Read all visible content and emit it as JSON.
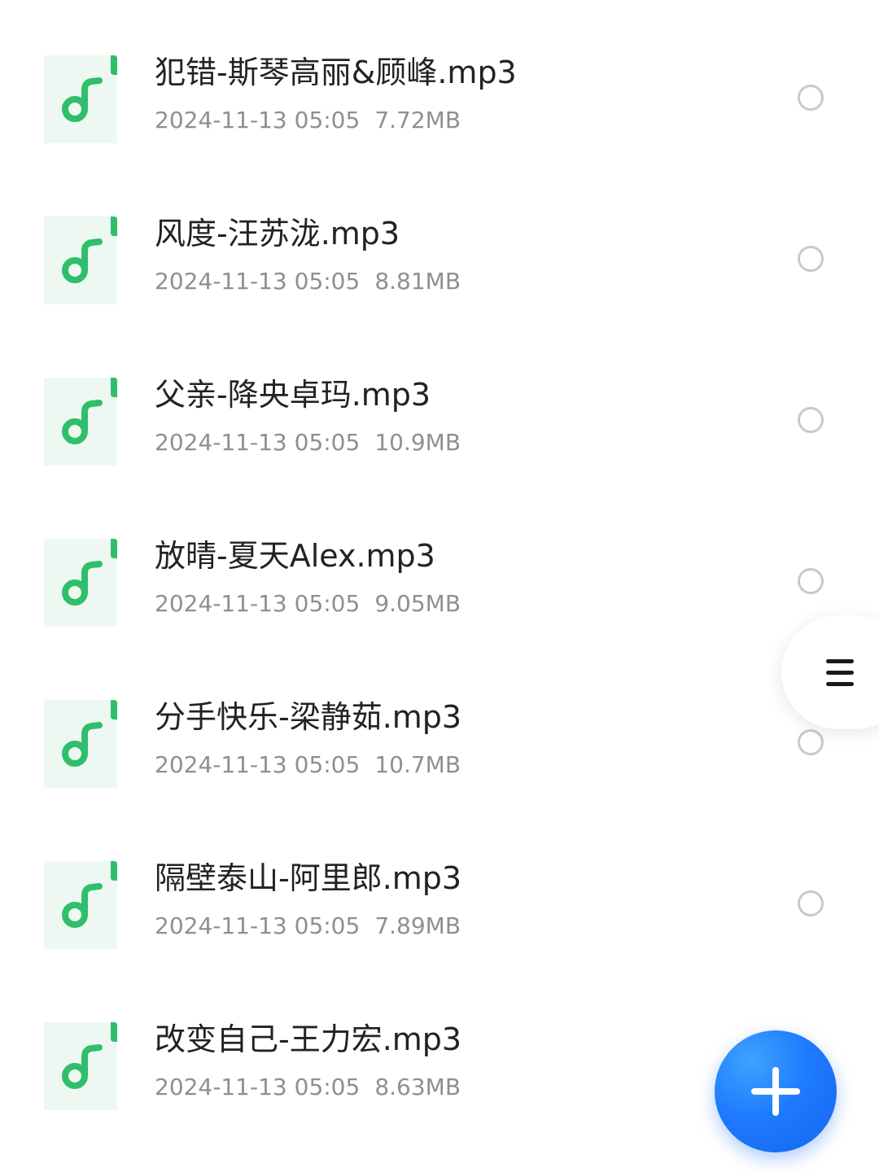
{
  "colors": {
    "icon_accent": "#2fbf6a",
    "icon_bg": "#eef8f2",
    "fab": "#1f7bff",
    "title_text": "#222222",
    "meta_text": "#8f8f8f"
  },
  "files": [
    {
      "name": "犯错-斯琴高丽&顾峰.mp3",
      "date": "2024-11-13 05:05",
      "size": "7.72MB",
      "selected": false,
      "icon": "music-file-icon"
    },
    {
      "name": "风度-汪苏泷.mp3",
      "date": "2024-11-13 05:05",
      "size": "8.81MB",
      "selected": false,
      "icon": "music-file-icon"
    },
    {
      "name": "父亲-降央卓玛.mp3",
      "date": "2024-11-13 05:05",
      "size": "10.9MB",
      "selected": false,
      "icon": "music-file-icon"
    },
    {
      "name": "放晴-夏天Alex.mp3",
      "date": "2024-11-13 05:05",
      "size": "9.05MB",
      "selected": false,
      "icon": "music-file-icon"
    },
    {
      "name": "分手快乐-梁静茹.mp3",
      "date": "2024-11-13 05:05",
      "size": "10.7MB",
      "selected": false,
      "icon": "music-file-icon"
    },
    {
      "name": "隔壁泰山-阿里郎.mp3",
      "date": "2024-11-13 05:05",
      "size": "7.89MB",
      "selected": false,
      "icon": "music-file-icon"
    },
    {
      "name": "改变自己-王力宏.mp3",
      "date": "2024-11-13 05:05",
      "size": "8.63MB",
      "selected": false,
      "icon": "music-file-icon"
    }
  ],
  "controls": {
    "menu_icon": "menu-icon",
    "fab_icon": "plus-icon"
  }
}
